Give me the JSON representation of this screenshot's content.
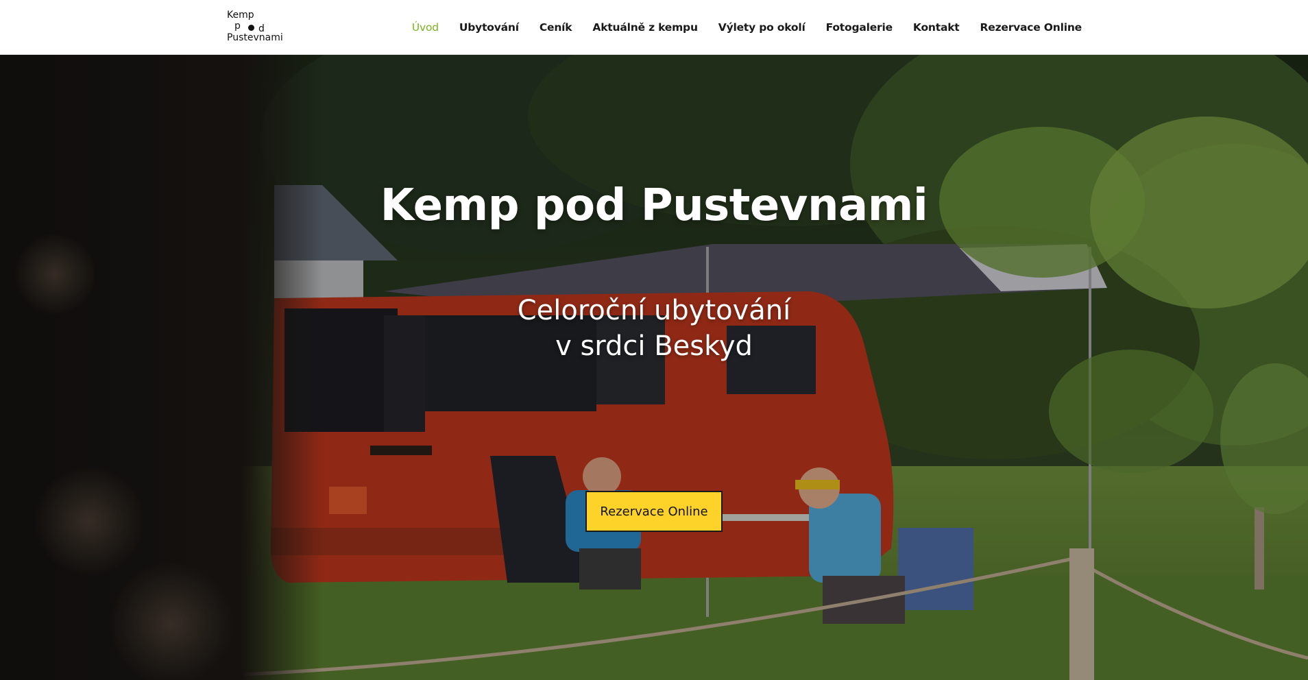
{
  "logo": {
    "line1": "Kemp",
    "line2": "p",
    "line3": "d",
    "line4": "Pustevnami"
  },
  "nav": {
    "items": [
      {
        "label": "Úvod"
      },
      {
        "label": "Ubytování"
      },
      {
        "label": "Ceník"
      },
      {
        "label": "Aktuálně z kempu"
      },
      {
        "label": "Výlety po okolí"
      },
      {
        "label": "Fotogalerie"
      },
      {
        "label": "Kontakt"
      },
      {
        "label": "Rezervace Online"
      }
    ],
    "active_color": "#7ab51d"
  },
  "hero": {
    "title": "Kemp pod Pustevnami",
    "subtitle_line1": "Celoroční ubytování",
    "subtitle_line2": "v srdci Beskyd",
    "cta_label": "Rezervace Online",
    "cta_color": "#fdd32a"
  }
}
